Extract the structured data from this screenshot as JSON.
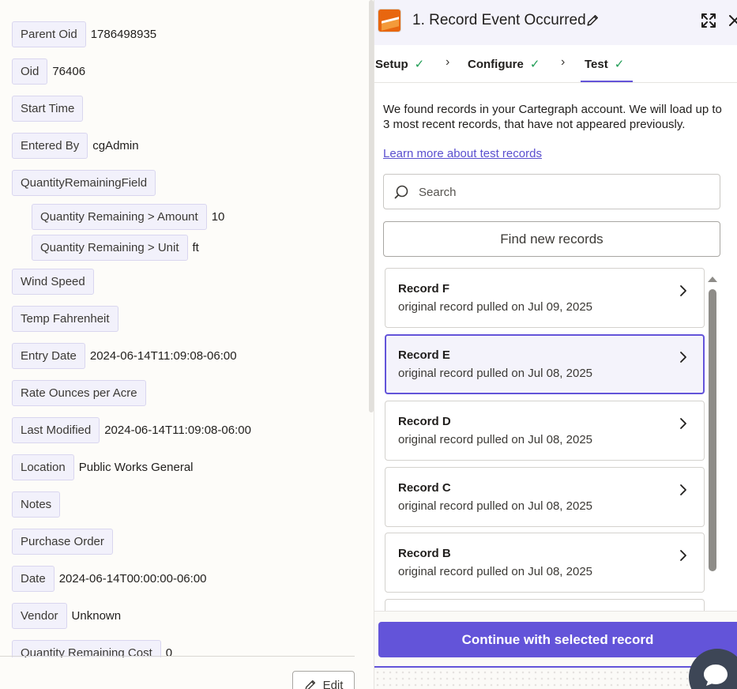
{
  "left_panel": {
    "fields": [
      {
        "key": "Parent Oid",
        "value": "1786498935"
      },
      {
        "key": "Oid",
        "value": "76406"
      },
      {
        "key": "Start Time",
        "value": ""
      },
      {
        "key": "Entered By",
        "value": "cgAdmin"
      },
      {
        "key": "QuantityRemainingField",
        "value": ""
      },
      {
        "key": "Quantity Remaining > Amount",
        "value": "10",
        "nested": true
      },
      {
        "key": "Quantity Remaining > Unit",
        "value": "ft",
        "nested": true
      },
      {
        "key": "Wind Speed",
        "value": ""
      },
      {
        "key": "Temp Fahrenheit",
        "value": ""
      },
      {
        "key": "Entry Date",
        "value": "2024-06-14T11:09:08-06:00"
      },
      {
        "key": "Rate Ounces per Acre",
        "value": ""
      },
      {
        "key": "Last Modified",
        "value": "2024-06-14T11:09:08-06:00"
      },
      {
        "key": "Location",
        "value": "Public Works General"
      },
      {
        "key": "Notes",
        "value": ""
      },
      {
        "key": "Purchase Order",
        "value": ""
      },
      {
        "key": "Date",
        "value": "2024-06-14T00:00:00-06:00"
      },
      {
        "key": "Vendor",
        "value": "Unknown"
      },
      {
        "key": "Quantity Remaining Cost",
        "value": "0"
      }
    ],
    "edit_label": "Edit"
  },
  "step": {
    "title": "1. Record Event Occurred",
    "app_logo_icon": "cartegraph-logo-icon",
    "accent_color": "#6354d9"
  },
  "tabs": [
    {
      "label": "Setup",
      "status": "complete"
    },
    {
      "label": "Configure",
      "status": "complete"
    },
    {
      "label": "Test",
      "status": "complete",
      "active": true
    }
  ],
  "test": {
    "intro": "We found records in your Cartegraph account. We will load up to 3 most recent records, that have not appeared previously.",
    "learn_more": "Learn more about test records",
    "search_placeholder": "Search",
    "find_button": "Find new records",
    "records": [
      {
        "title": "Record F",
        "subtitle": "original record pulled on Jul 09, 2025"
      },
      {
        "title": "Record E",
        "subtitle": "original record pulled on Jul 08, 2025",
        "selected": true
      },
      {
        "title": "Record D",
        "subtitle": "original record pulled on Jul 08, 2025"
      },
      {
        "title": "Record C",
        "subtitle": "original record pulled on Jul 08, 2025"
      },
      {
        "title": "Record B",
        "subtitle": "original record pulled on Jul 08, 2025"
      }
    ],
    "continue_button": "Continue with selected record"
  }
}
